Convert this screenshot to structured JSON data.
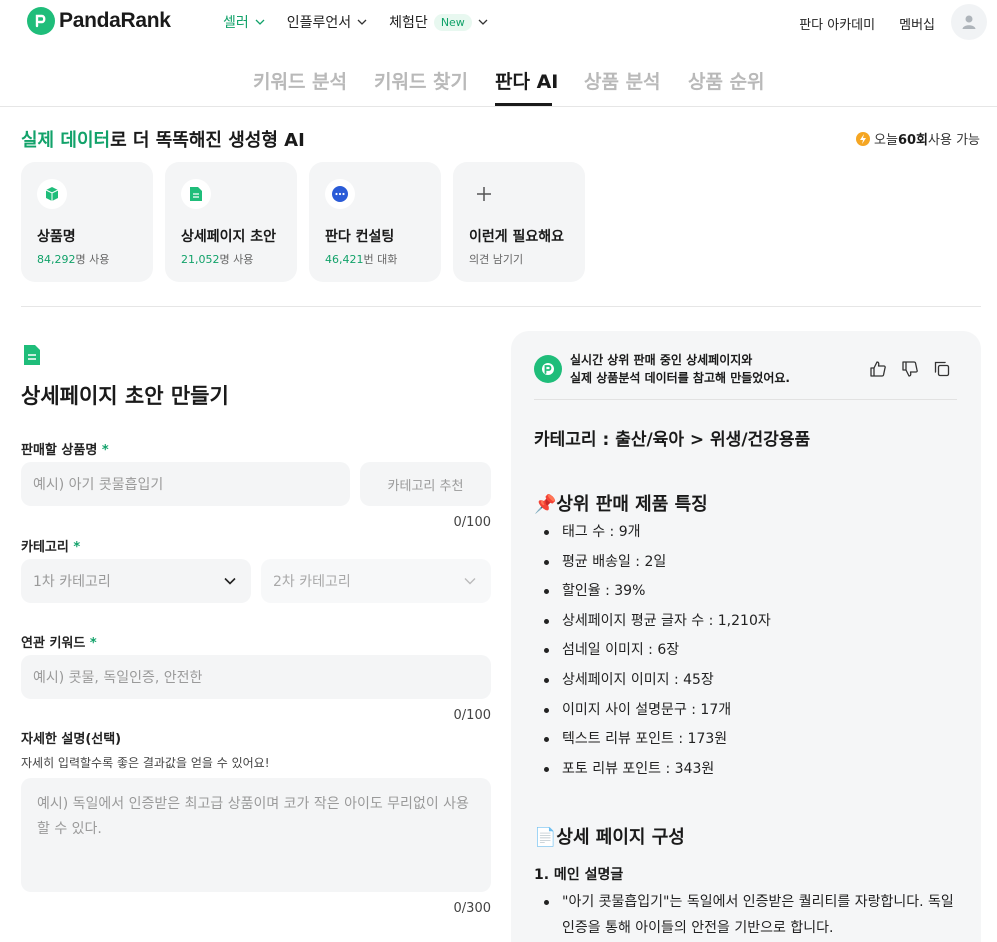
{
  "brand": {
    "name": "PandaRank",
    "color": "#1fbd7a"
  },
  "nav": {
    "items": [
      {
        "label": "셀러",
        "active": true
      },
      {
        "label": "인플루언서",
        "active": false
      },
      {
        "label": "체험단",
        "active": false,
        "badge": "New"
      }
    ],
    "links": [
      "판다 아카데미",
      "멤버십"
    ]
  },
  "tabs": [
    "키워드 분석",
    "키워드 찾기",
    "판다 AI",
    "상품 분석",
    "상품 순위"
  ],
  "active_tab": "판다 AI",
  "headline": {
    "highlight": "실제 데이터",
    "rest": "로 더 똑똑해진 생성형 AI"
  },
  "usage": {
    "prefix": "오늘 ",
    "count": "60회",
    "suffix": " 사용 가능"
  },
  "cards": [
    {
      "title": "상품명",
      "num": "84,292",
      "unit": "명 사용",
      "icon": "box-icon"
    },
    {
      "title": "상세페이지 초안",
      "num": "21,052",
      "unit": "명 사용",
      "icon": "document-icon"
    },
    {
      "title": "판다 컨설팅",
      "num": "46,421",
      "unit": "번 대화",
      "icon": "chat-icon"
    },
    {
      "title": "이런게 필요해요",
      "num": "",
      "unit": "의견 남기기",
      "icon": "plus-icon"
    }
  ],
  "form": {
    "title": "상세페이지 초안 만들기",
    "product": {
      "label": "판매할 상품명",
      "required": "*",
      "placeholder": "예시) 아기 콧물흡입기",
      "button": "카테고리 추천",
      "counter": "0/100"
    },
    "category": {
      "label": "카테고리",
      "required": "*",
      "first": "1차 카테고리",
      "second": "2차 카테고리"
    },
    "keywords": {
      "label": "연관 키워드",
      "required": "*",
      "placeholder": "예시) 콧물, 독일인증, 안전한",
      "counter": "0/100"
    },
    "detail": {
      "label": "자세한 설명(선택)",
      "hint": "자세히 입력할수록 좋은 결과값을 얻을 수 있어요!",
      "placeholder": "예시) 독일에서 인증받은 최고급 상품이며 코가 작은 아이도 무리없이 사용할 수 있다.",
      "counter": "0/300"
    }
  },
  "result": {
    "message_line1": "실시간 상위 판매 중인 상세페이지와",
    "message_line2": "실제 상품분석 데이터를 참고해 만들었어요.",
    "category_line": "카테고리 : 출산/육아 > 위생/건강용품",
    "features_head": "📌상위 판매 제품 특징",
    "features": [
      "태그 수 : 9개",
      "평균 배송일 : 2일",
      "할인율 : 39%",
      "상세페이지 평균 글자 수 : 1,210자",
      "섬네일 이미지 : 6장",
      "상세페이지 이미지 : 45장",
      "이미지 사이 설명문구 : 17개",
      "텍스트 리뷰 포인트 : 173원",
      "포토 리뷰 포인트 : 343원"
    ],
    "structure_head": "📄상세 페이지 구성",
    "main_desc_head": "1. 메인 설명글",
    "main_desc": "\"아기 콧물흡입기\"는 독일에서 인증받은 퀄리티를 자랑합니다. 독일인증을 통해 아이들의 안전을 기반으로 합니다."
  }
}
